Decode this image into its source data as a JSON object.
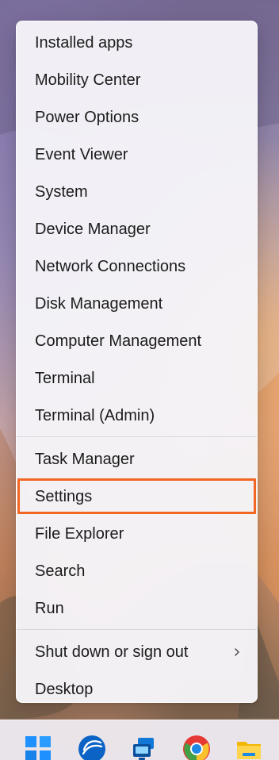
{
  "menu": {
    "items": [
      {
        "label": "Installed apps",
        "name": "menu-item-installed-apps"
      },
      {
        "label": "Mobility Center",
        "name": "menu-item-mobility-center"
      },
      {
        "label": "Power Options",
        "name": "menu-item-power-options"
      },
      {
        "label": "Event Viewer",
        "name": "menu-item-event-viewer"
      },
      {
        "label": "System",
        "name": "menu-item-system"
      },
      {
        "label": "Device Manager",
        "name": "menu-item-device-manager"
      },
      {
        "label": "Network Connections",
        "name": "menu-item-network-connections"
      },
      {
        "label": "Disk Management",
        "name": "menu-item-disk-management"
      },
      {
        "label": "Computer Management",
        "name": "menu-item-computer-management"
      },
      {
        "label": "Terminal",
        "name": "menu-item-terminal"
      },
      {
        "label": "Terminal (Admin)",
        "name": "menu-item-terminal-admin"
      },
      {
        "label": "Task Manager",
        "name": "menu-item-task-manager"
      },
      {
        "label": "Settings",
        "name": "menu-item-settings"
      },
      {
        "label": "File Explorer",
        "name": "menu-item-file-explorer"
      },
      {
        "label": "Search",
        "name": "menu-item-search"
      },
      {
        "label": "Run",
        "name": "menu-item-run"
      },
      {
        "label": "Shut down or sign out",
        "name": "menu-item-shut-down-or-sign-out"
      },
      {
        "label": "Desktop",
        "name": "menu-item-desktop"
      }
    ],
    "selected_label": "Settings",
    "submenu_icon": "chevron-right-icon"
  },
  "taskbar": {
    "icons": [
      {
        "name": "windows-start-icon",
        "color": "#1e90ff"
      },
      {
        "name": "globe-app-icon",
        "color": "#0b63c5"
      },
      {
        "name": "remote-desktop-icon",
        "color": "#1178d8"
      },
      {
        "name": "chrome-icon",
        "color": "#e53935"
      },
      {
        "name": "file-explorer-folder-icon",
        "color": "#f2b705"
      }
    ]
  },
  "colors": {
    "selection_outline": "#f26522",
    "menu_background": "#f5f4f8",
    "menu_text": "#1b1b1b"
  }
}
